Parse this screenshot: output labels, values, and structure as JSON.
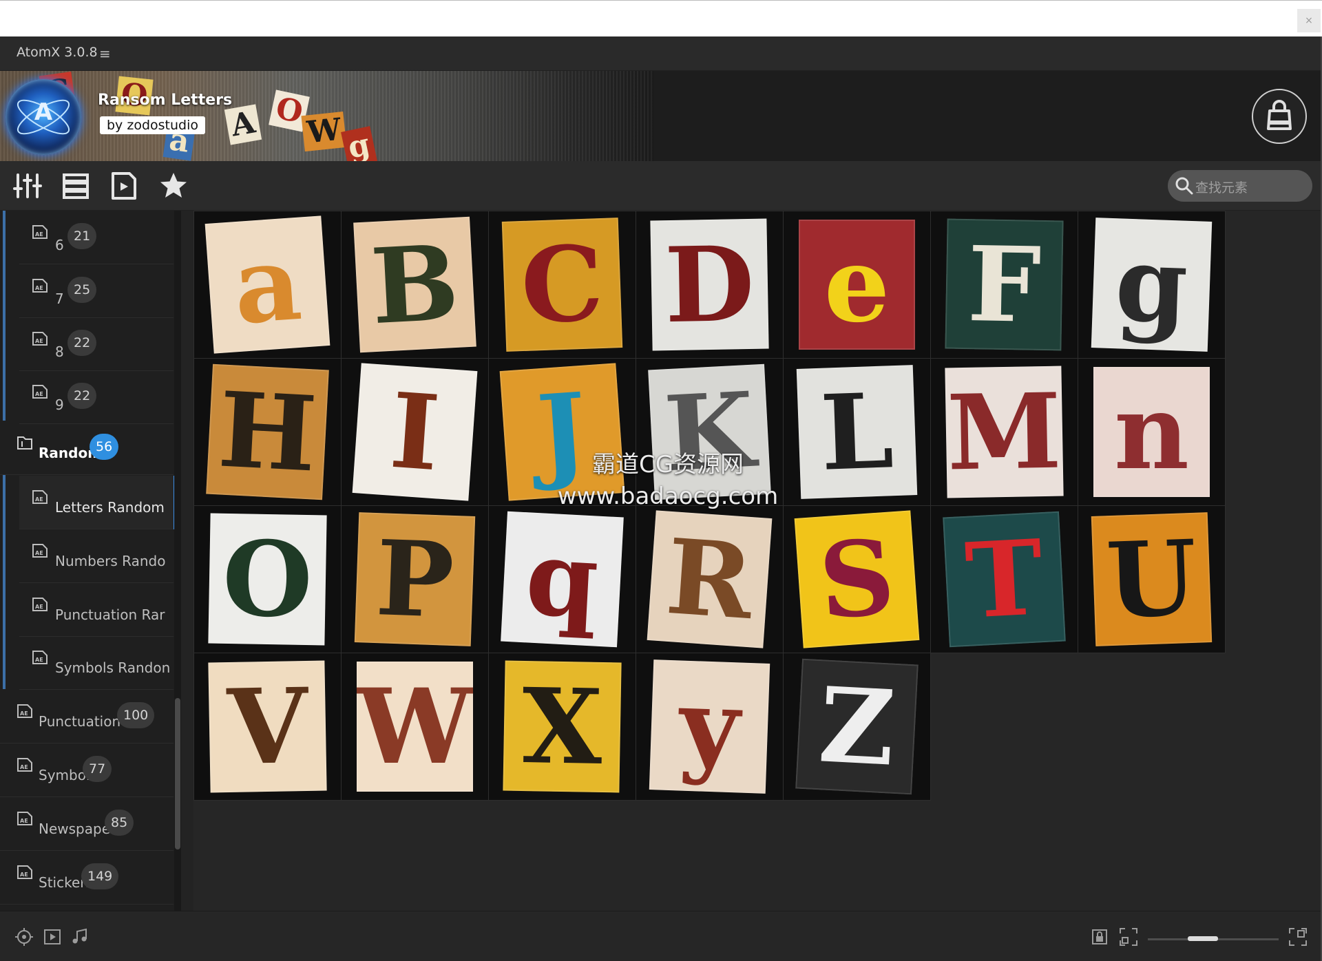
{
  "app": {
    "title": "AtomX 3.0.8",
    "menu_icon": "hamburger-menu-icon",
    "close_glyph": "×"
  },
  "banner": {
    "title": "Ransom Letters",
    "author": "by zodostudio",
    "logo_letter": "A",
    "decor_letters": [
      "C",
      "O",
      "A",
      "O",
      "W",
      "a",
      "g"
    ],
    "shop_icon": "shopping-bag-icon"
  },
  "toolbar": {
    "tools": [
      "sliders-icon",
      "list-view-icon",
      "media-file-icon",
      "star-icon"
    ],
    "search": {
      "placeholder": "查找元素",
      "icon": "search-icon"
    }
  },
  "sidebar": {
    "items": [
      {
        "label": "6",
        "count": "21",
        "level": "sub",
        "icon": "ae-file-icon"
      },
      {
        "label": "7",
        "count": "25",
        "level": "sub",
        "icon": "ae-file-icon"
      },
      {
        "label": "8",
        "count": "22",
        "level": "sub",
        "icon": "ae-file-icon"
      },
      {
        "label": "9",
        "count": "22",
        "level": "sub",
        "icon": "ae-file-icon"
      },
      {
        "label": "Random",
        "count": "56",
        "level": "category",
        "icon": "folder-icon"
      },
      {
        "label": "Letters Random",
        "level": "sub",
        "icon": "ae-file-icon",
        "selected": true
      },
      {
        "label": "Numbers Rando",
        "level": "sub",
        "icon": "ae-file-icon"
      },
      {
        "label": "Punctuation Rar",
        "level": "sub",
        "icon": "ae-file-icon"
      },
      {
        "label": "Symbols Randon",
        "level": "sub",
        "icon": "ae-file-icon"
      },
      {
        "label": "Punctuation",
        "count": "100",
        "level": "category",
        "icon": "ae-file-icon"
      },
      {
        "label": "Symbols",
        "count": "77",
        "level": "category",
        "icon": "ae-file-icon"
      },
      {
        "label": "Newspaper",
        "count": "85",
        "level": "category",
        "icon": "ae-file-icon"
      },
      {
        "label": "Stickers",
        "count": "149",
        "level": "category",
        "icon": "ae-file-icon"
      }
    ]
  },
  "grid": {
    "tiles": [
      {
        "letter": "a",
        "bg": "#efdcc4",
        "fg": "#d98a2e"
      },
      {
        "letter": "B",
        "bg": "#e8c9a6",
        "fg": "#2f3b22"
      },
      {
        "letter": "C",
        "bg": "#d69a24",
        "fg": "#8a1a1e"
      },
      {
        "letter": "D",
        "bg": "#e4e4e0",
        "fg": "#7b1a1a"
      },
      {
        "letter": "e",
        "bg": "#a02a2e",
        "fg": "#f2d21a"
      },
      {
        "letter": "F",
        "bg": "#1f4038",
        "fg": "#e9e4d6"
      },
      {
        "letter": "g",
        "bg": "#e6e6e2",
        "fg": "#2b2b2b"
      },
      {
        "letter": "H",
        "bg": "#c98a3a",
        "fg": "#2a2116"
      },
      {
        "letter": "I",
        "bg": "#f1ede6",
        "fg": "#7a2e16"
      },
      {
        "letter": "J",
        "bg": "#e09a2a",
        "fg": "#1d8fb5"
      },
      {
        "letter": "K",
        "bg": "#d7d7d3",
        "fg": "#555555"
      },
      {
        "letter": "L",
        "bg": "#e2e2de",
        "fg": "#1f1f1f"
      },
      {
        "letter": "M",
        "bg": "#eae0da",
        "fg": "#8a2a2a"
      },
      {
        "letter": "n",
        "bg": "#ead7d0",
        "fg": "#8e2e30"
      },
      {
        "letter": "O",
        "bg": "#ededea",
        "fg": "#1f3a26"
      },
      {
        "letter": "P",
        "bg": "#d2953e",
        "fg": "#2a241a"
      },
      {
        "letter": "q",
        "bg": "#ececec",
        "fg": "#7e1a1a"
      },
      {
        "letter": "R",
        "bg": "#e6d3bd",
        "fg": "#7a4a26"
      },
      {
        "letter": "S",
        "bg": "#f1c419",
        "fg": "#8a1a3a"
      },
      {
        "letter": "T",
        "bg": "#1d4a4a",
        "fg": "#d8262a"
      },
      {
        "letter": "U",
        "bg": "#db8a1e",
        "fg": "#171717"
      },
      {
        "letter": "V",
        "bg": "#f0dcc0",
        "fg": "#5a3218"
      },
      {
        "letter": "W",
        "bg": "#f2dfc8",
        "fg": "#8a3a26"
      },
      {
        "letter": "X",
        "bg": "#e5b82a",
        "fg": "#221d14"
      },
      {
        "letter": "y",
        "bg": "#ead9c6",
        "fg": "#8a2e20"
      },
      {
        "letter": "Z",
        "bg": "#2a2a2a",
        "fg": "#eeeeee"
      }
    ]
  },
  "watermark": {
    "line1": "霸道CG资源网",
    "line2": "www.badaocg.com"
  },
  "status_bar": {
    "left_icons": [
      "crosshair-icon",
      "video-icon",
      "music-icon"
    ],
    "right_icons": [
      "lock-icon",
      "fullscreen-icon",
      "expand-icon"
    ],
    "zoom_level": 0.4
  }
}
